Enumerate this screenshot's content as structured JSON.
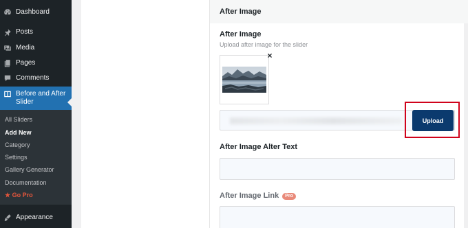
{
  "sidebar": {
    "items": [
      {
        "label": "Dashboard",
        "icon": "dashboard-icon"
      },
      {
        "label": "Posts",
        "icon": "pin-icon"
      },
      {
        "label": "Media",
        "icon": "media-icon"
      },
      {
        "label": "Pages",
        "icon": "pages-icon"
      },
      {
        "label": "Comments",
        "icon": "comments-icon"
      },
      {
        "label": "Before and After Slider",
        "icon": "slider-icon",
        "active": true
      },
      {
        "label": "Appearance",
        "icon": "paintbrush-icon"
      }
    ],
    "submenu": [
      {
        "label": "All Sliders"
      },
      {
        "label": "Add New",
        "current": true
      },
      {
        "label": "Category"
      },
      {
        "label": "Settings"
      },
      {
        "label": "Gallery Generator"
      },
      {
        "label": "Documentation"
      },
      {
        "label": "★ Go Pro"
      }
    ]
  },
  "section": {
    "title": "After Image"
  },
  "fields": {
    "after_image": {
      "label": "After Image",
      "description": "Upload after image for the slider",
      "remove_symbol": "×",
      "upload_label": "Upload"
    },
    "alt_text": {
      "label": "After Image Alter Text",
      "value": ""
    },
    "link": {
      "label": "After Image Link",
      "badge": "Pro",
      "value": ""
    }
  },
  "colors": {
    "sidebar_bg": "#1d2327",
    "active_bg": "#2271b1",
    "upload_button": "#0b3a6e",
    "highlight_border": "#d0021b",
    "pro_badge": "#e98a7a",
    "go_pro": "#e5563b"
  }
}
